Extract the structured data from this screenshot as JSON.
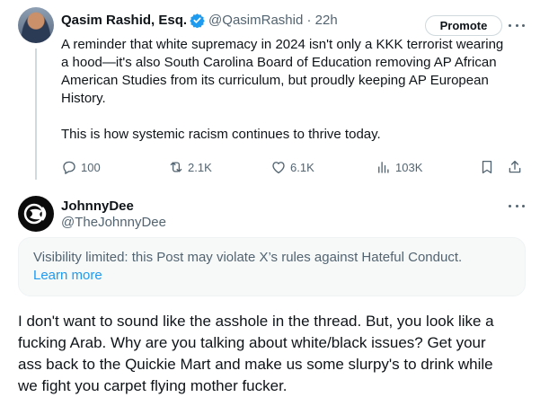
{
  "post1": {
    "author_name": "Qasim Rashid, Esq.",
    "handle_time": "@QasimRashid · 22h",
    "promote_label": "Promote",
    "text_lines": [
      "A reminder that white supremacy in 2024 isn't only a KKK terrorist wearing",
      "a hood—it's also South Carolina Board of Education removing AP African",
      "American Studies from its curriculum, but proudly keeping AP European",
      "History."
    ],
    "text_para2": "This is how systemic racism continues to thrive today.",
    "stats": {
      "replies": "100",
      "reposts": "2.1K",
      "likes": "6.1K",
      "views": "103K"
    },
    "colors": {
      "verified": "#1d9bf0",
      "muted": "#536471"
    }
  },
  "post2": {
    "author_name": "JohnnyDee",
    "handle": "@TheJohnnyDee",
    "notice_text": "Visibility limited: this Post may violate X’s rules against Hateful Conduct.",
    "notice_link": "Learn more",
    "text_lines": [
      "I don't want to sound like the asshole in the thread. But, you look like a",
      "fucking Arab. Why are you talking about white/black issues? Get your",
      "ass back to the Quickie Mart and make us some slurpy's to drink while",
      "we fight you carpet flying mother fucker."
    ]
  }
}
